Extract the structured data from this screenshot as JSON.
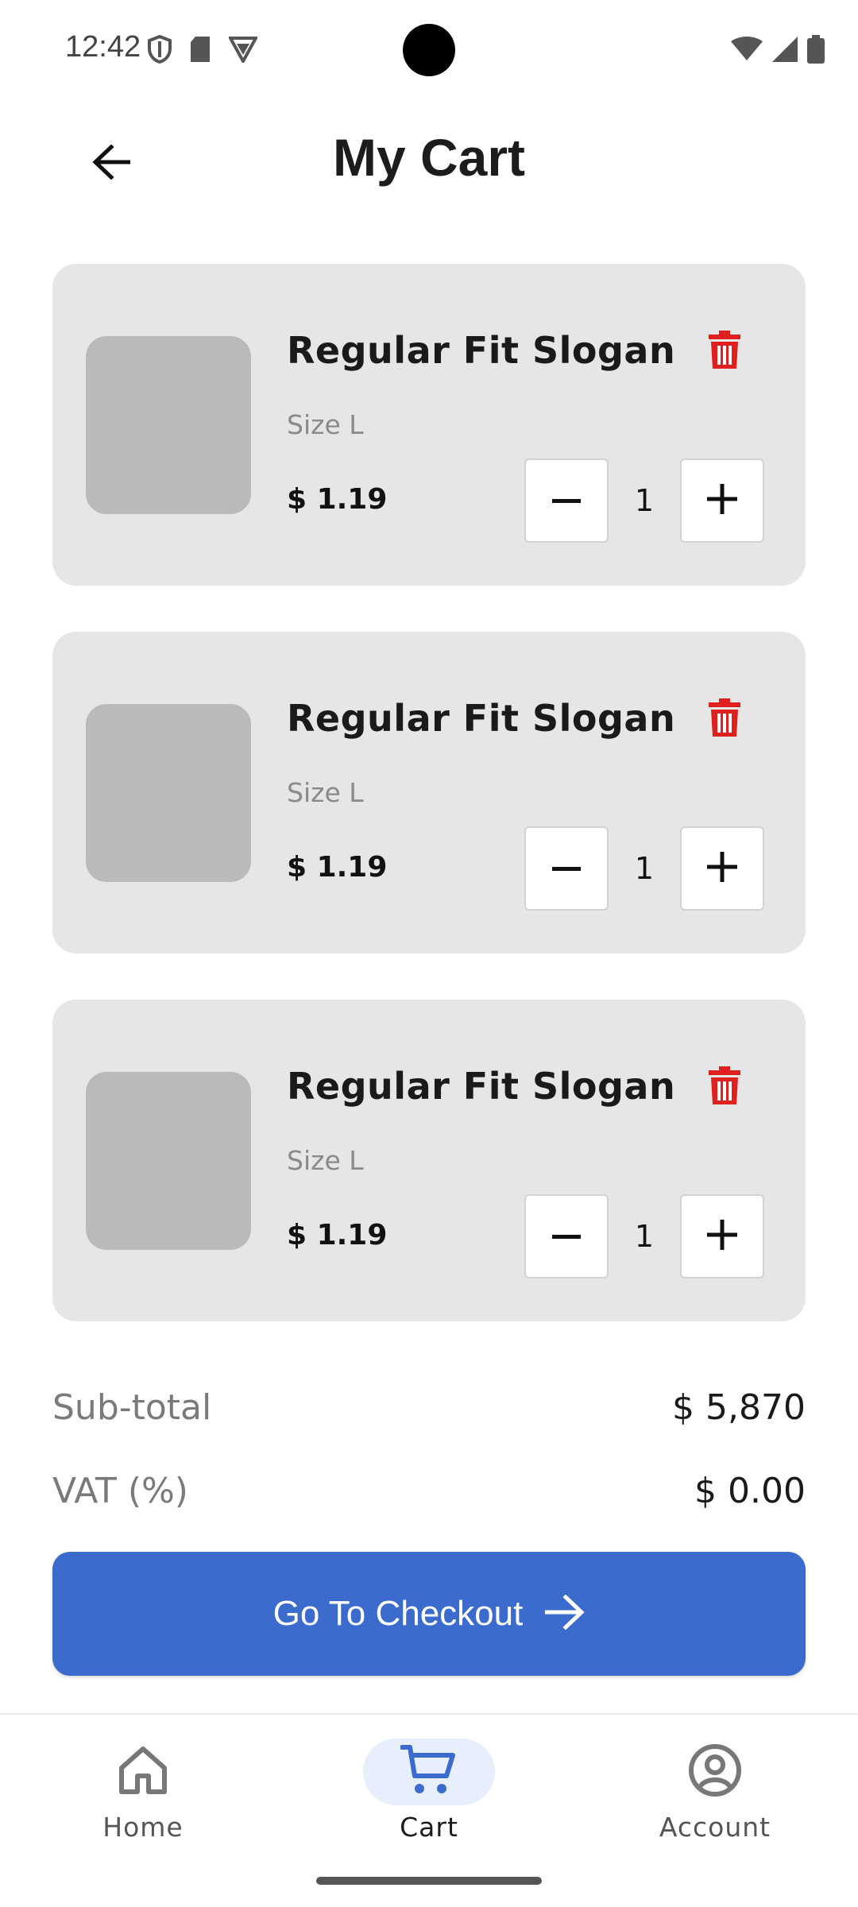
{
  "status_bar": {
    "time": "12:42",
    "left_icons": [
      "shield-icon",
      "sd-card-icon",
      "vpn-icon"
    ],
    "right_icons": [
      "wifi-icon",
      "signal-icon",
      "battery-icon"
    ]
  },
  "header": {
    "title": "My Cart",
    "back_icon": "arrow-left-icon"
  },
  "cart": {
    "items": [
      {
        "name": "Regular Fit Slogan",
        "size": "Size L",
        "price": "$ 1.19",
        "quantity": "1"
      },
      {
        "name": "Regular Fit Slogan",
        "size": "Size L",
        "price": "$ 1.19",
        "quantity": "1"
      },
      {
        "name": "Regular Fit Slogan",
        "size": "Size L",
        "price": "$ 1.19",
        "quantity": "1"
      }
    ]
  },
  "summary": {
    "subtotal_label": "Sub-total",
    "subtotal_value": "$ 5,870",
    "vat_label": "VAT (%)",
    "vat_value": "$ 0.00"
  },
  "checkout": {
    "label": "Go To Checkout",
    "icon": "arrow-right-icon"
  },
  "bottom_nav": {
    "items": [
      {
        "label": "Home",
        "icon": "home-icon",
        "active": false
      },
      {
        "label": "Cart",
        "icon": "cart-icon",
        "active": true
      },
      {
        "label": "Account",
        "icon": "account-icon",
        "active": false
      }
    ]
  },
  "colors": {
    "accent": "#3b6bcd",
    "delete": "#e0201e",
    "card_bg": "#e6e6e6",
    "thumb_bg": "#bababa",
    "nav_active_bg": "#e7eefc"
  }
}
